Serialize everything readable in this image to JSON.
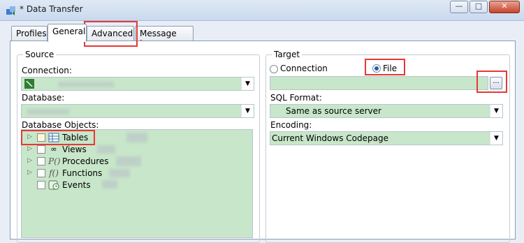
{
  "window": {
    "title": "* Data Transfer",
    "buttons": {
      "minimize": "—",
      "maximize": "□",
      "close": "✕"
    }
  },
  "tabs": [
    {
      "label": "Profiles"
    },
    {
      "label": "General"
    },
    {
      "label": "Advanced"
    },
    {
      "label": "Message Log"
    }
  ],
  "source": {
    "legend": "Source",
    "connection_label": "Connection:",
    "database_label": "Database:",
    "objects_label": "Database Objects:",
    "objects": [
      {
        "label": "Tables",
        "icon": "table-icon"
      },
      {
        "label": "Views",
        "icon": "views-icon"
      },
      {
        "label": "Procedures",
        "icon": "procedure-icon"
      },
      {
        "label": "Functions",
        "icon": "function-icon"
      },
      {
        "label": "Events",
        "icon": "event-icon"
      }
    ]
  },
  "target": {
    "legend": "Target",
    "radio_connection": "Connection",
    "radio_file": "File",
    "selected": "File",
    "browse_label": "...",
    "sql_format_label": "SQL Format:",
    "sql_format_value": "Same as source server",
    "encoding_label": "Encoding:",
    "encoding_value": "Current Windows Codepage"
  },
  "colors": {
    "field_bg": "#c8e6c9",
    "highlight": "#e53935",
    "radio_dot": "#1f5fa8"
  }
}
